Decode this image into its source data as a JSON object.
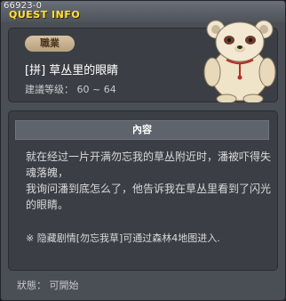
{
  "window": {
    "quest_id": "66923-0",
    "title": "QUEST INFO"
  },
  "quest": {
    "category": "職業",
    "name": "[拼] 草丛里的眼睛",
    "level": "建議等级： 60 ~ 64",
    "npc_icon": "bear-npc-portrait"
  },
  "content": {
    "header": "內容",
    "line1": "就在经过一片开满勿忘我的草丛附近时，潘被吓得失魂落魄，",
    "line2": "我询问潘到底怎么了，他告诉我在草丛里看到了闪光的眼睛。",
    "note": "※ 隐藏剧情[勿忘我草]可通过森林4地图进入."
  },
  "status": {
    "text": "狀態： 可開始"
  },
  "colors": {
    "title_yellow": "#ffe13a",
    "pill_tan": "#c9b190",
    "panel_bg": "#3b3f45"
  }
}
